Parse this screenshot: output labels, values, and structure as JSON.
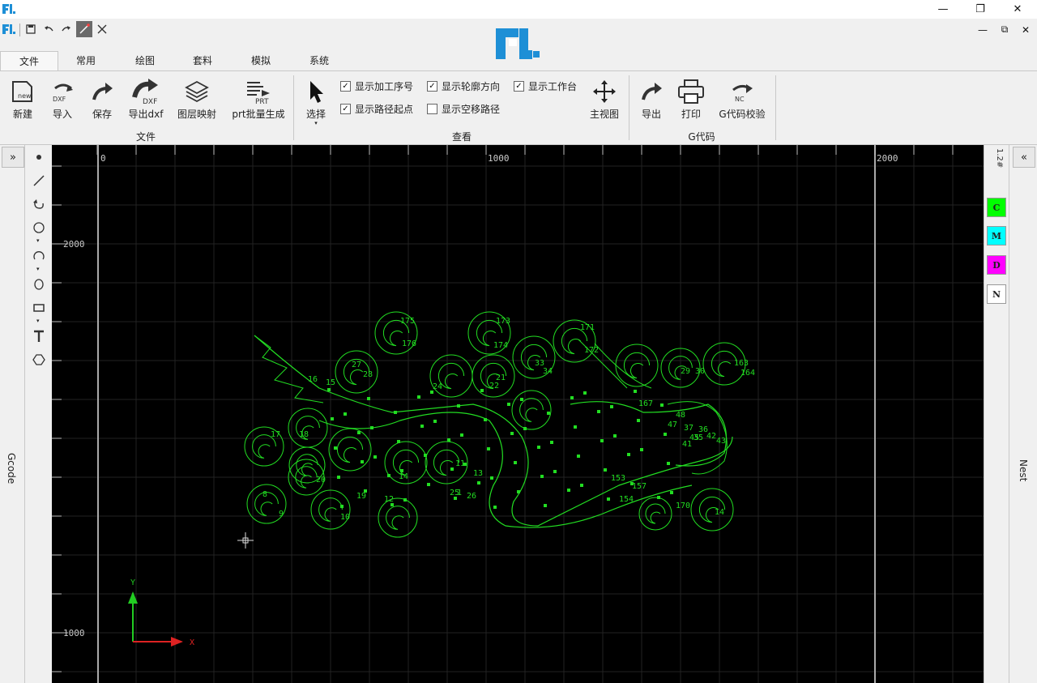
{
  "window": {
    "app_logo": "FL-logo-icon",
    "controls": {
      "minimize": "—",
      "restore": "❐",
      "close": "✕"
    }
  },
  "qat": {
    "icons": [
      "app-icon",
      "save-icon",
      "undo-icon",
      "redo-icon",
      "draw-line-icon",
      "close-drawing-icon"
    ],
    "mdi_controls": {
      "minimize": "—",
      "restore": "⧉",
      "close": "✕"
    }
  },
  "tabs": [
    {
      "label": "文件",
      "active": true
    },
    {
      "label": "常用"
    },
    {
      "label": "绘图"
    },
    {
      "label": "套料"
    },
    {
      "label": "模拟"
    },
    {
      "label": "系统"
    }
  ],
  "ribbon": {
    "file_group": {
      "title": "文件",
      "buttons": [
        {
          "label": "新建",
          "icon": "new-file-icon",
          "icon_text": "new"
        },
        {
          "label": "导入",
          "icon": "import-dxf-icon",
          "icon_text": "DXF"
        },
        {
          "label": "保存",
          "icon": "save-arrow-icon"
        },
        {
          "label": "导出dxf",
          "icon": "export-dxf-icon",
          "icon_text": "DXF"
        },
        {
          "label": "图层映射",
          "icon": "layers-icon"
        },
        {
          "label": "prt批量生成",
          "icon": "prt-batch-icon",
          "icon_text": "PRT"
        }
      ]
    },
    "view_group": {
      "title": "查看",
      "select_label": "选择",
      "checkboxes": [
        {
          "label": "显示加工序号",
          "checked": true
        },
        {
          "label": "显示轮廓方向",
          "checked": true
        },
        {
          "label": "显示工作台",
          "checked": true
        },
        {
          "label": "显示路径起点",
          "checked": true
        },
        {
          "label": "显示空移路径",
          "checked": false
        }
      ],
      "main_view_label": "主视图"
    },
    "gcode_group": {
      "title": "G代码",
      "buttons": [
        {
          "label": "导出",
          "icon": "export-arrow-icon"
        },
        {
          "label": "打印",
          "icon": "printer-icon"
        },
        {
          "label": "G代码校验",
          "icon": "nc-check-icon",
          "icon_text": "NC"
        }
      ]
    }
  },
  "left_panel": {
    "toggle": "»",
    "label": "Gcode"
  },
  "right_panel": {
    "toggle": "«",
    "label": "Nest",
    "strip_label": "1.2#"
  },
  "layers": [
    {
      "label": "C",
      "color": "#00ff00"
    },
    {
      "label": "M",
      "color": "#00ffff"
    },
    {
      "label": "D",
      "color": "#ff00ff"
    },
    {
      "label": "N",
      "color": "#ffffff"
    }
  ],
  "canvas": {
    "x_ruler_labels": [
      "0",
      "1000",
      "2000"
    ],
    "y_ruler_labels": [
      "2000",
      "1000"
    ],
    "axis": {
      "x": "X",
      "y": "Y"
    },
    "part_color": "#22dd22",
    "sequence_numbers": [
      "175",
      "173",
      "171",
      "176",
      "174",
      "172",
      "167",
      "33",
      "34",
      "27",
      "28",
      "29",
      "30",
      "163",
      "164",
      "16",
      "15",
      "17",
      "18",
      "19",
      "20",
      "1",
      "8",
      "10",
      "12",
      "14",
      "11",
      "13",
      "24",
      "22",
      "21",
      "25",
      "26",
      "45",
      "43",
      "42",
      "41",
      "47",
      "48",
      "35",
      "37",
      "36",
      "153",
      "154",
      "157",
      "170",
      "14",
      "9"
    ]
  }
}
